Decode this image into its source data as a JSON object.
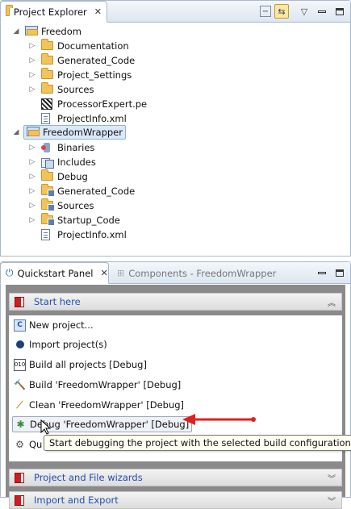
{
  "project_explorer": {
    "tab_label": "Project Explorer",
    "tree": {
      "freedom": {
        "label": "Freedom",
        "children": [
          "Documentation",
          "Generated_Code",
          "Project_Settings",
          "Sources",
          "ProcessorExpert.pe",
          "ProjectInfo.xml"
        ]
      },
      "freedom_wrapper": {
        "label": "FreedomWrapper",
        "children": [
          "Binaries",
          "Includes",
          "Debug",
          "Generated_Code",
          "Sources",
          "Startup_Code",
          "ProjectInfo.xml"
        ]
      }
    }
  },
  "quickstart": {
    "tab_label": "Quickstart Panel",
    "components_tab_label": "Components - FreedomWrapper",
    "start_here": "Start here",
    "items": [
      "New project...",
      "Import project(s)",
      "Build all projects [Debug]",
      "Build 'FreedomWrapper' [Debug]",
      "Clean 'FreedomWrapper' [Debug]",
      "Debug 'FreedomWrapper' [Debug]",
      "Qu"
    ],
    "tooltip": "Start debugging the project with the selected build configuration",
    "sections": [
      "Project and File wizards",
      "Import and Export"
    ]
  },
  "colors": {
    "arrow": "#e02020",
    "section_title": "#1f4fb5",
    "selection": "#dae8f8"
  }
}
